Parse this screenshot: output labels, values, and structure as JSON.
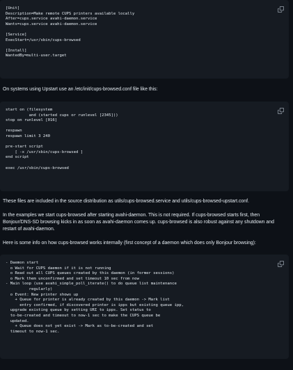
{
  "code_blocks": [
    {
      "content": "[Unit]\nDescription=Make remote CUPS printers available locally\nAfter=cups.service avahi-daemon.service\nWants=cups.service avahi-daemon.service\n\n[Service]\nExecStart=/usr/sbin/cups-browsed\n\n[Install]\nWantedBy=multi-user.target"
    },
    {
      "content": "start on (filesystem\n          and (started cups or runlevel [2345]))\nstop on runlevel [016]\n\nrespawn\nrespawn limit 3 240\n\npre-start script\n    [ -x /usr/sbin/cups-browsed ]\nend script\n\nexec /usr/sbin/cups-browsed"
    },
    {
      "content": "- Daemon start\n  o Wait for CUPS daemon if it is not running\n  o Read out all CUPS queues created by this daemon (in former sessions)\n  o Mark them unconfirmed and set timeout 10 sec from now\n- Main loop (use avahi_simple_poll_iterate() to do queue list maintenance\n          regularly)\n  o Event: New printer shows up\n    + Queue for printer is already created by this daemon -> Mark list\n      entry confirmed, if discovered printer is ipps but existing queue ipp,\n  upgrade existing queue by setting URI to ipps. Set status to\n  to-be-created and timeout to now-1 sec to make the CUPS queue be\n  updated.\n    + Queue does not yet exist -> Mark as to-be-created and set\n  timeout to now-1 sec."
    }
  ],
  "paragraphs": {
    "upstart": "On systems using Upstart use an /etc/init/cups-browsed.conf file like this:",
    "files": "These files are included in the source distribution as utils/cups-browsed.service and utils/cups-browsed-upstart.conf.",
    "examples": "In the examples we start cups-browsed after starting avahi-daemon. This is not required. If cups-browsed starts first, then Bonjour/DNS-SD browsing kicks in as soon as avahi-daemon comes up. cups-browsed is also robust against any shutdown and restart of avahi-daemon.",
    "internals": "Here is some info on how cups-browsed works internally (first concept of a daemon which does only Bonjour browsing):"
  },
  "icons": {
    "copy": "copy-icon"
  },
  "colors": {
    "background": "#0d1117",
    "code_background": "#161b22",
    "text": "#e6edf3",
    "icon": "#8b949e"
  }
}
